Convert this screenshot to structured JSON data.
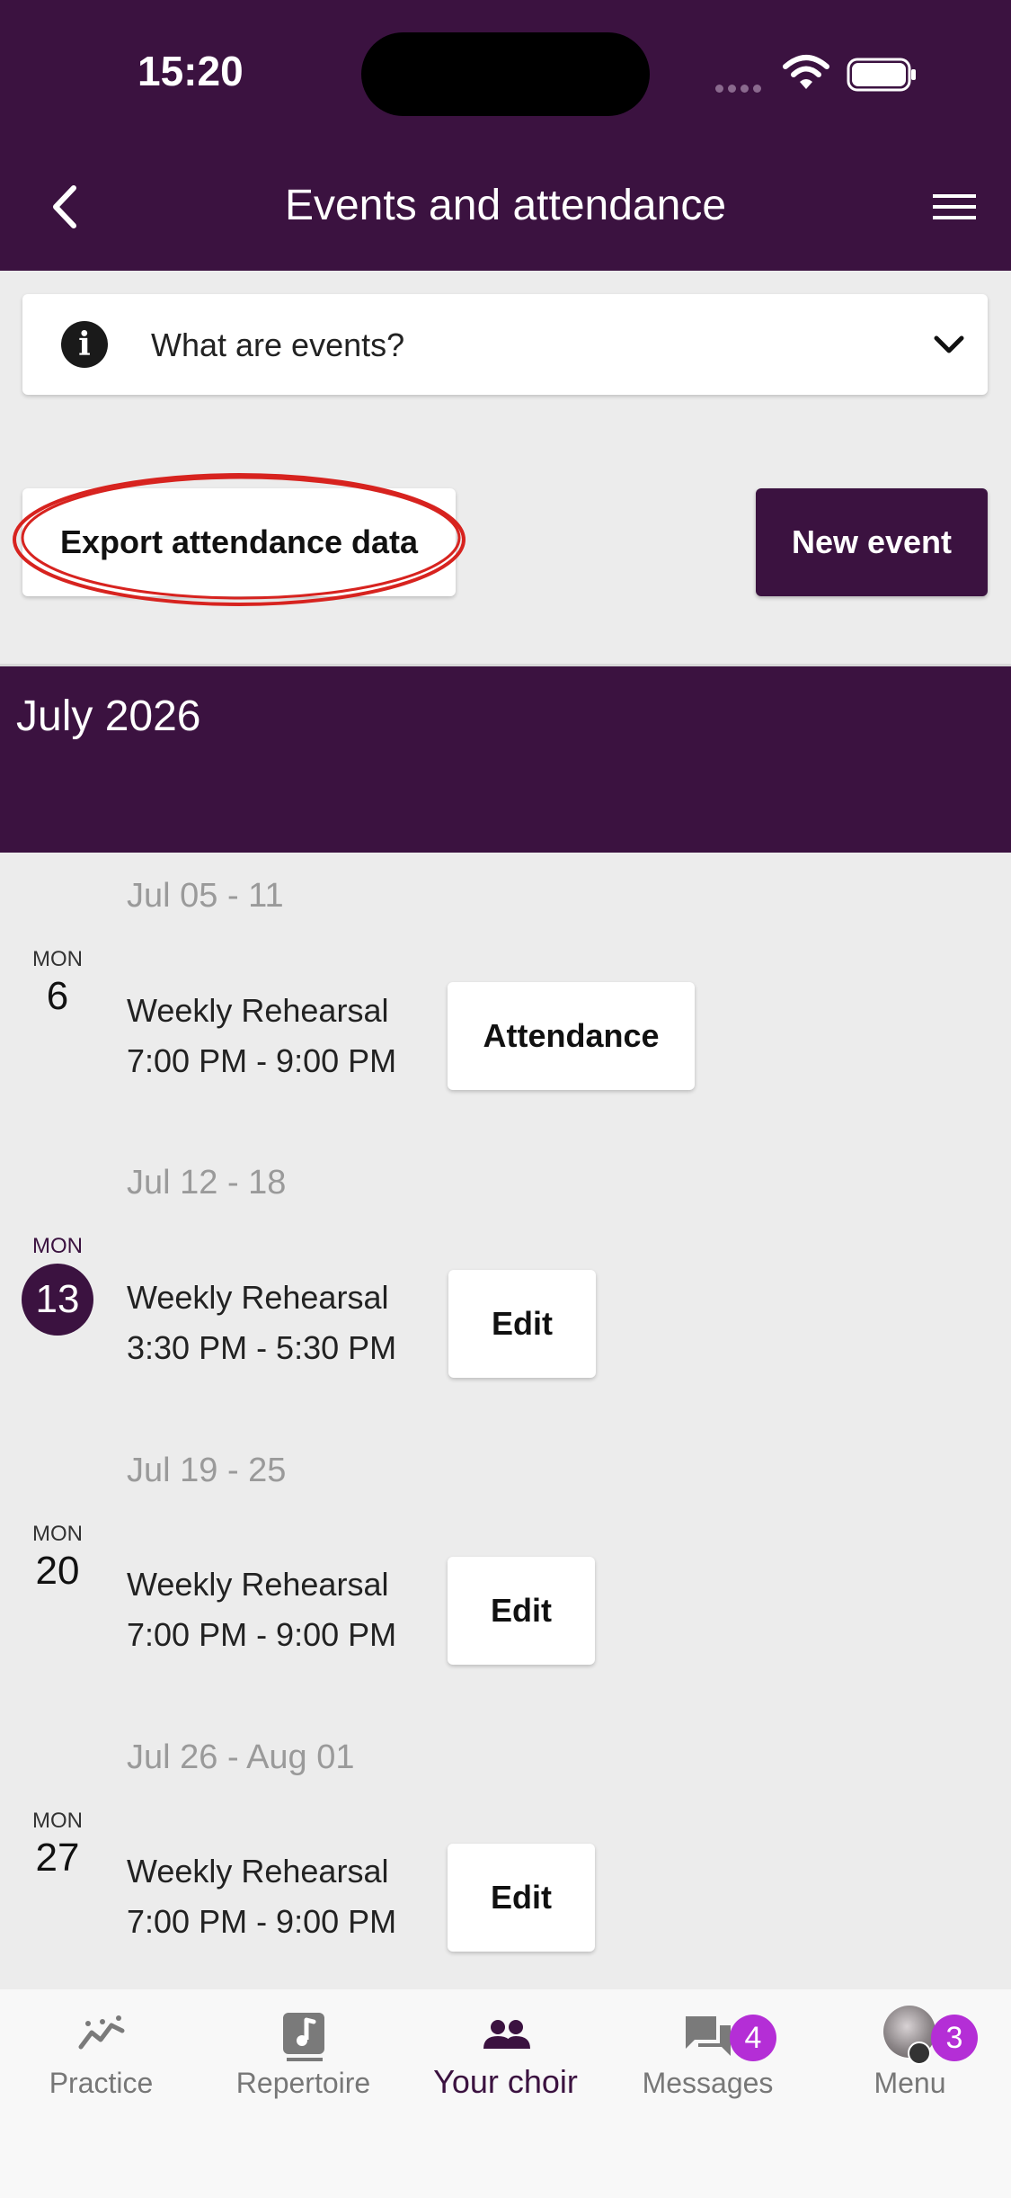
{
  "status_bar": {
    "time": "15:20"
  },
  "header": {
    "title": "Events and attendance"
  },
  "info_panel": {
    "text": "What are events?",
    "icon_glyph": "i"
  },
  "actions": {
    "export_label": "Export attendance data",
    "new_event_label": "New event"
  },
  "month": {
    "label": "July 2026"
  },
  "weeks": [
    {
      "range": "Jul 05 - 11",
      "day_name": "MON",
      "day_num": "6",
      "title": "Weekly Rehearsal",
      "time": "7:00 PM - 9:00 PM",
      "button": "Attendance",
      "today": false
    },
    {
      "range": "Jul 12 - 18",
      "day_name": "MON",
      "day_num": "13",
      "title": "Weekly Rehearsal",
      "time": "3:30 PM - 5:30 PM",
      "button": "Edit",
      "today": true
    },
    {
      "range": "Jul 19 - 25",
      "day_name": "MON",
      "day_num": "20",
      "title": "Weekly Rehearsal",
      "time": "7:00 PM - 9:00 PM",
      "button": "Edit",
      "today": false
    },
    {
      "range": "Jul 26 - Aug 01",
      "day_name": "MON",
      "day_num": "27",
      "title": "Weekly Rehearsal",
      "time": "7:00 PM - 9:00 PM",
      "button": "Edit",
      "today": false
    }
  ],
  "bottom_nav": {
    "items": [
      {
        "label": "Practice",
        "icon": "practice-icon"
      },
      {
        "label": "Repertoire",
        "icon": "music-note-icon"
      },
      {
        "label": "Your choir",
        "icon": "group-icon",
        "active": true
      },
      {
        "label": "Messages",
        "icon": "chat-icon",
        "badge": "4"
      },
      {
        "label": "Menu",
        "icon": "avatar",
        "badge": "3"
      }
    ]
  },
  "colors": {
    "primary": "#3b1240",
    "badge": "#b42ed6",
    "background": "#ececec",
    "highlight_ring": "#d7231f"
  }
}
